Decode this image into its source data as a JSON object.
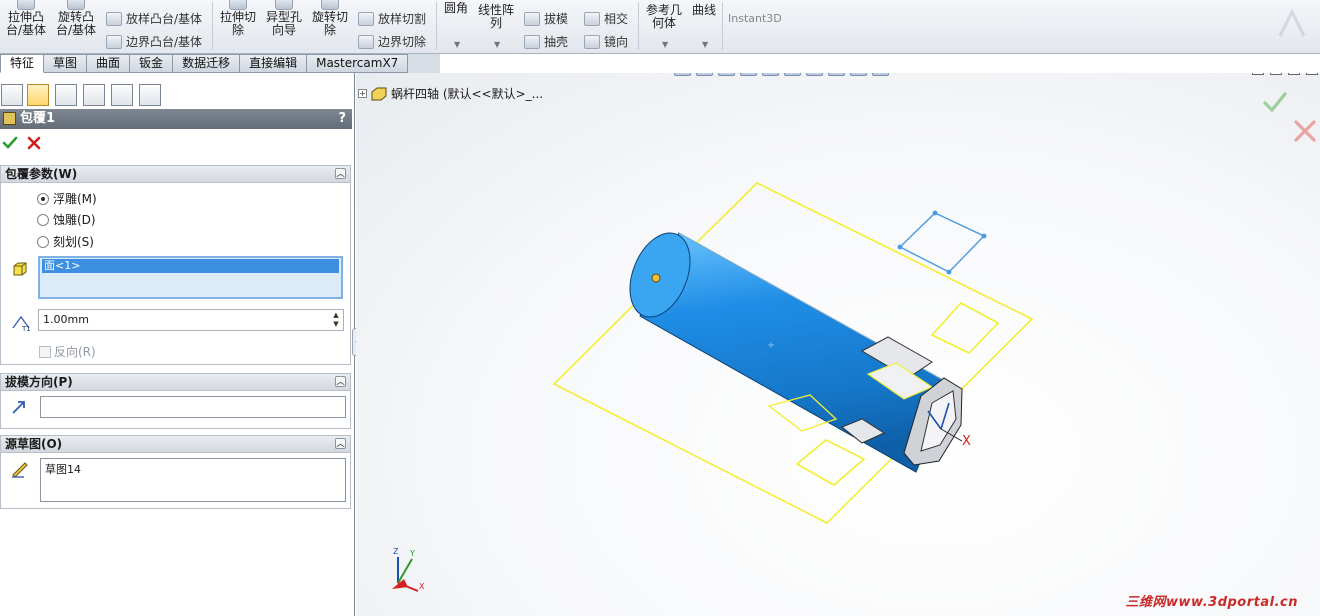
{
  "ribbon": {
    "big_buttons": [
      {
        "label1": "拉伸凸",
        "label2": "台/基体"
      },
      {
        "label1": "旋转凸",
        "label2": "台/基体"
      },
      {
        "label1": "拉伸切",
        "label2": "除"
      },
      {
        "label1": "异型孔",
        "label2": "向导"
      },
      {
        "label1": "旋转切",
        "label2": "除"
      },
      {
        "label1": "圆角",
        "label2": ""
      },
      {
        "label1": "线性阵",
        "label2": "列"
      },
      {
        "label1": "参考几",
        "label2": "何体"
      },
      {
        "label1": "曲线",
        "label2": ""
      }
    ],
    "small_buttons": {
      "loft_boss": "放样凸台/基体",
      "boundary_boss": "边界凸台/基体",
      "loft_cut": "放样切割",
      "boundary_cut": "边界切除",
      "draft": "拔模",
      "shell": "抽壳",
      "intersect": "相交",
      "mirror": "镜向"
    },
    "instant3d": "Instant3D"
  },
  "tabs": [
    "特征",
    "草图",
    "曲面",
    "钣金",
    "数据迁移",
    "直接编辑",
    "MastercamX7"
  ],
  "property_manager": {
    "title": "包覆1",
    "help": "?",
    "groups": {
      "wrap_params": {
        "header": "包覆参数(W)",
        "options": [
          "浮雕(M)",
          "蚀雕(D)",
          "刻划(S)"
        ],
        "selected_option": 0,
        "face_selection": "面<1>",
        "thickness": "1.00mm",
        "reverse": "反向(R)"
      },
      "pull_direction": {
        "header": "拔模方向(P)",
        "value": ""
      },
      "source_sketch": {
        "header": "源草图(O)",
        "value": "草图14"
      }
    }
  },
  "graphics": {
    "tree_label": "蜗杆四轴  (默认<<默认>_...",
    "triad_labels": {
      "x": "X",
      "y": "Y",
      "z": "Z"
    },
    "watermark": "三维网www.3dportal.cn"
  },
  "colors": {
    "part": "#1f8de6",
    "sketch": "#f2ee33",
    "accent_ok": "#3aa53a",
    "accent_cancel": "#d42020"
  }
}
